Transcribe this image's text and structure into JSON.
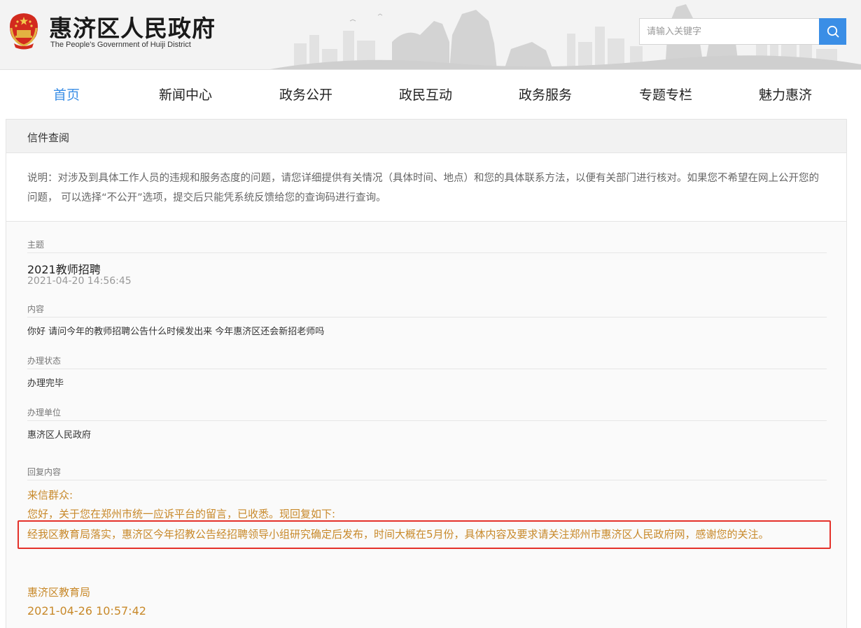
{
  "header": {
    "title": "惠济区人民政府",
    "subtitle": "The People's Government of Huiji District",
    "search_placeholder": "请输入关键字",
    "accent_color": "#3a8ee6"
  },
  "nav": {
    "items": [
      {
        "label": "首页",
        "active": true
      },
      {
        "label": "新闻中心",
        "active": false
      },
      {
        "label": "政务公开",
        "active": false
      },
      {
        "label": "政民互动",
        "active": false
      },
      {
        "label": "政务服务",
        "active": false
      },
      {
        "label": "专题专栏",
        "active": false
      },
      {
        "label": "魅力惠济",
        "active": false
      }
    ]
  },
  "panel": {
    "title": "信件查阅",
    "notice": "说明：对涉及到具体工作人员的违规和服务态度的问题，请您详细提供有关情况（具体时间、地点）和您的具体联系方法，以便有关部门进行核对。如果您不希望在网上公开您的问题， 可以选择“不公开”选项，提交后只能凭系统反馈给您的查询码进行查询。"
  },
  "letter": {
    "subject_label": "主题",
    "subject": "2021教师招聘",
    "subject_date": "2021-04-20 14:56:45",
    "content_label": "内容",
    "content": "你好 请问今年的教师招聘公告什么时候发出来 今年惠济区还会新招老师吗",
    "status_label": "办理状态",
    "status": "办理完毕",
    "unit_label": "办理单位",
    "unit": "惠济区人民政府",
    "reply_label": "回复内容",
    "reply_greeting": "来信群众:",
    "reply_intro": "您好，关于您在郑州市统一应诉平台的留言，已收悉。现回复如下:",
    "reply_body": "经我区教育局落实，惠济区今年招教公告经招聘领导小组研究确定后发布，时间大概在5月份，具体内容及要求请关注郑州市惠济区人民政府网，感谢您的关注。",
    "reply_from": "惠济区教育局",
    "reply_date": "2021-04-26 10:57:42",
    "reply_color": "#c8892a",
    "highlight_color": "#e4312a"
  }
}
